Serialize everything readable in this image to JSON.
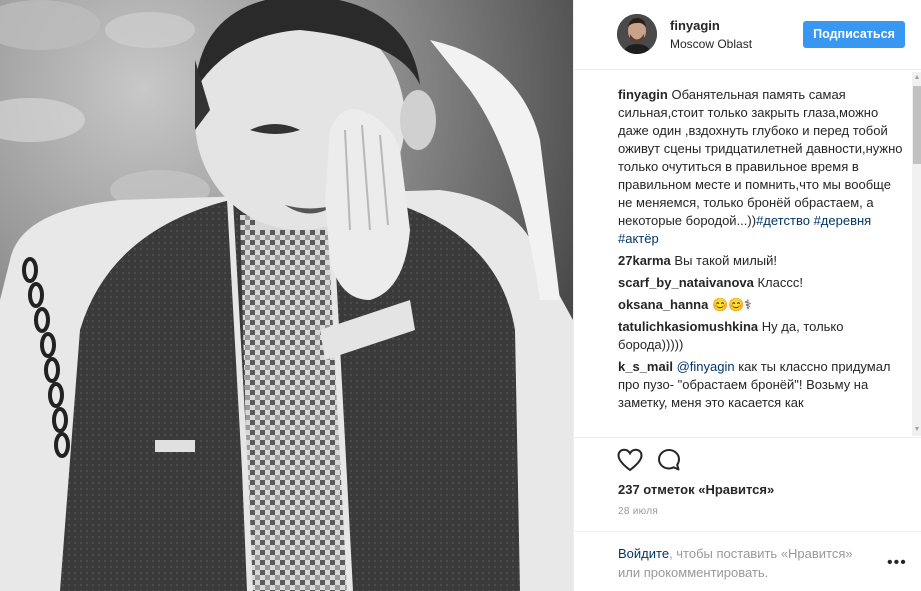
{
  "header": {
    "username": "finyagin",
    "location": "Moscow Oblast",
    "follow_label": "Подписаться"
  },
  "comments": [
    {
      "user": "finyagin",
      "text": "Обанятельная память самая сильная,стоит только закрыть глаза,можно даже один ,вздохнуть глубоко и перед тобой оживут сцены тридцатилетней давности,нужно только очутиться в правильное время в правильном месте и помнить,что мы вообще не меняемся, только бронёй обрастаем, а некоторые бородой...))",
      "tags": [
        "#детство",
        "#деревня",
        "#актёр"
      ]
    },
    {
      "user": "27karma",
      "text": "Вы такой милый!"
    },
    {
      "user": "scarf_by_nataivanova",
      "text": "Классс!"
    },
    {
      "user": "oksana_hanna",
      "text": "😊😊⚕"
    },
    {
      "user": "tatulichkasiomushkina",
      "text": "Ну да, только борода)))))"
    },
    {
      "user": "k_s_mail",
      "mention": "@finyagin",
      "text": "как ты классно придумал про пузо- \"обрастаем бронёй\"! Возьму на заметку, меня это касается как"
    }
  ],
  "actions": {
    "like_icon": "heart-icon",
    "comment_icon": "comment-icon",
    "likes_text": "237 отметок «Нравится»",
    "date": "28 июля"
  },
  "login": {
    "link": "Войдите",
    "rest": ", чтобы поставить «Нравится» или прокомментировать.",
    "more": "•••"
  }
}
